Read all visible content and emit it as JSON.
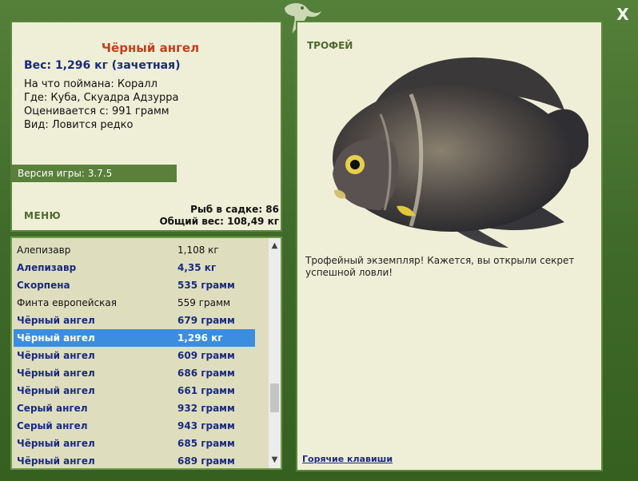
{
  "window": {
    "close_label": "X"
  },
  "catch": {
    "title": "Чёрный ангел",
    "weight": "Вес: 1,296 кг (зачетная)",
    "bait": "На что поймана: Коралл",
    "place": "Где: Куба, Скуадра Адзурра",
    "valued": "Оценивается с: 991 грамм",
    "rarity": "Вид: Ловится редко"
  },
  "version": "Версия игры: 3.7.5",
  "menu_label": "МЕНЮ",
  "stats": {
    "fish_count": "Рыб в садке: 86",
    "total_weight": "Общий вес: 108,49 кг"
  },
  "fish_list": [
    {
      "name": "Алепизавр",
      "weight": "1,108 кг",
      "style": "normal"
    },
    {
      "name": "Алепизавр",
      "weight": "4,35 кг",
      "style": "bold"
    },
    {
      "name": "Скорпена",
      "weight": "535 грамм",
      "style": "bold"
    },
    {
      "name": "Финта европейская",
      "weight": "559 грамм",
      "style": "normal"
    },
    {
      "name": "Чёрный ангел",
      "weight": "679 грамм",
      "style": "bold"
    },
    {
      "name": "Чёрный ангел",
      "weight": "1,296 кг",
      "style": "selected"
    },
    {
      "name": "Чёрный ангел",
      "weight": "609 грамм",
      "style": "bold"
    },
    {
      "name": "Чёрный ангел",
      "weight": "686 грамм",
      "style": "bold"
    },
    {
      "name": "Чёрный ангел",
      "weight": "661 грамм",
      "style": "bold"
    },
    {
      "name": "Серый ангел",
      "weight": "932 грамм",
      "style": "bold"
    },
    {
      "name": "Серый ангел",
      "weight": "943 грамм",
      "style": "bold"
    },
    {
      "name": "Чёрный ангел",
      "weight": "685 грамм",
      "style": "bold"
    },
    {
      "name": "Чёрный ангел",
      "weight": "689 грамм",
      "style": "bold"
    }
  ],
  "trophy": {
    "label": "ТРОФЕЙ",
    "description": "Трофейный экземпляр! Кажется, вы открыли секрет успешной ловли!",
    "hotkeys": "Горячие клавиши"
  },
  "icons": {
    "close": "close-icon",
    "logo": "lizard-logo-icon",
    "scroll_up": "chevron-up-icon",
    "scroll_down": "chevron-down-icon"
  },
  "colors": {
    "frame": "#4a6e34",
    "panel": "#efefd8",
    "title": "#c0401a",
    "accent_text": "#1a2a7a",
    "selection": "#3b8de0"
  }
}
